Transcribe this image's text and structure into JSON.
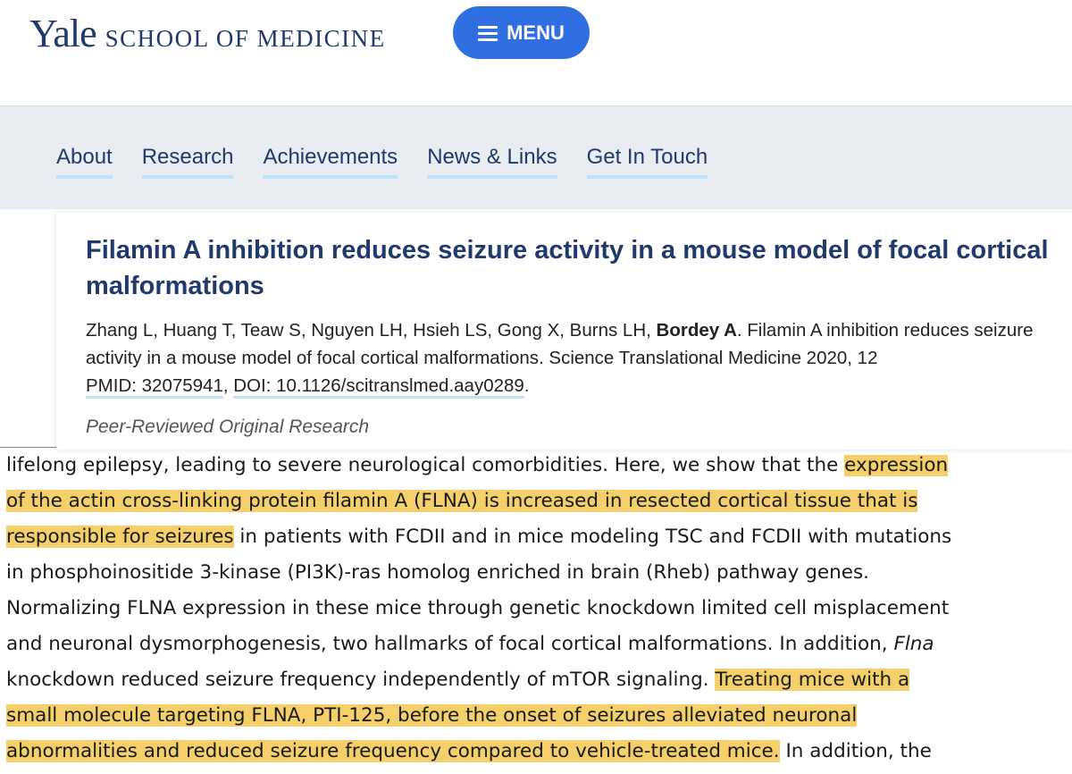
{
  "header": {
    "logo_primary": "Yale",
    "logo_secondary": "SCHOOL OF MEDICINE",
    "menu_label": "MENU"
  },
  "nav": {
    "items": [
      "About",
      "Research",
      "Achievements",
      "News & Links",
      "Get In Touch"
    ]
  },
  "publication": {
    "title": "Filamin A inhibition reduces seizure activity in a mouse model of focal cortical malformations",
    "authors_before": "Zhang L, Huang T, Teaw S, Nguyen LH, Hsieh LS, Gong X, Burns LH, ",
    "author_bold": "Bordey A",
    "citation_rest": ". Filamin A inhibition reduces seizure activity in a mouse model of focal cortical malformations. Science Translational Medicine 2020, 12",
    "pmid": "PMID: 32075941",
    "separator": ", ",
    "doi": "DOI: 10.1126/scitranslmed.aay0289",
    "end": ".",
    "type": "Peer-Reviewed Original Research"
  },
  "abstract": {
    "l1a": "lifelong epilepsy, leading to severe neurological comorbidities. Here, we show that the ",
    "l1b": "expression",
    "l2": "of the actin cross-linking protein filamin A (FLNA) is increased in resected cortical tissue that is",
    "l3a": "responsible for seizures",
    "l3b": " in patients with FCDII and in mice modeling TSC and FCDII with mutations",
    "l4": "in phosphoinositide 3-kinase (PI3K)-ras homolog enriched in brain (Rheb) pathway genes.",
    "l5": "Normalizing FLNA expression in these mice through genetic knockdown limited cell misplacement",
    "l6a": "and neuronal dysmorphogenesis, two hallmarks of focal cortical malformations. In addition, ",
    "l6b": "Flna",
    "l7a": "knockdown reduced seizure frequency independently of mTOR signaling. ",
    "l7b": "Treating mice with a",
    "l8": "small molecule targeting FLNA, PTI-125, before the onset of seizures alleviated neuronal",
    "l9a": "abnormalities and reduced seizure frequency compared to vehicle-treated mice.",
    "l9b": " In addition, the",
    "highlight_color": "#f5cf6a"
  },
  "colors": {
    "brand_navy": "#1f3a6b",
    "menu_blue": "#2f6fe2",
    "link_underline": "#bde3f7",
    "nav_band": "#e9ecf1"
  }
}
